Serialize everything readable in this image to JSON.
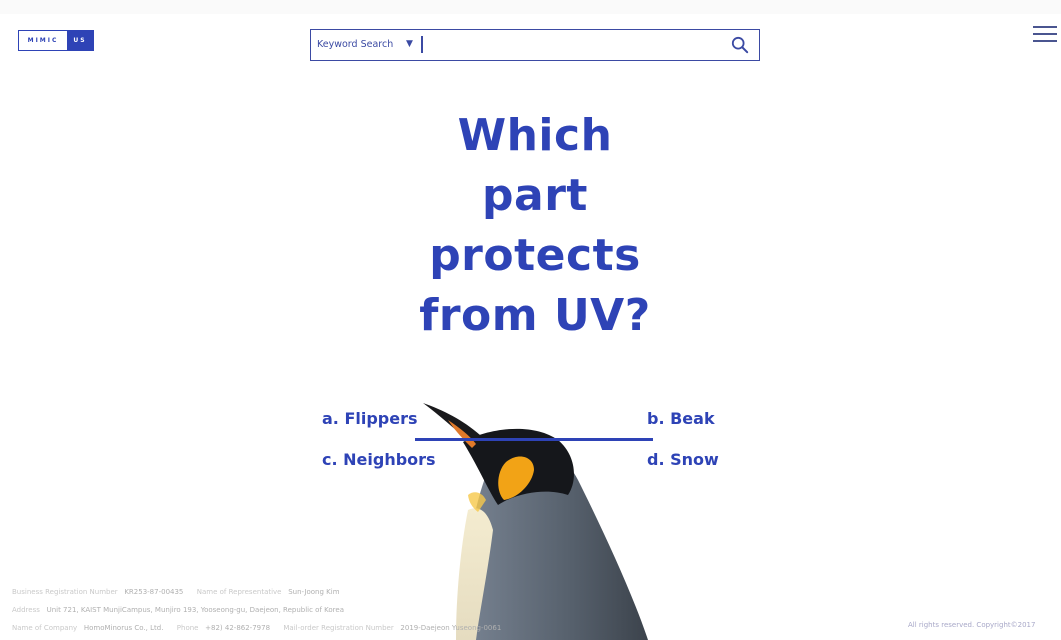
{
  "header": {
    "logo": {
      "left": "MIMIC",
      "right": "US"
    },
    "search": {
      "type_label": "Keyword Search",
      "caret": "▼",
      "value": ""
    },
    "menu_icon": "hamburger-icon"
  },
  "question": {
    "lines": [
      "Which",
      "part",
      "protects",
      "from UV?"
    ]
  },
  "answers": {
    "a": "a. Flippers",
    "b": "b. Beak",
    "c": "c. Neighbors",
    "d": "d. Snow"
  },
  "footer": {
    "reg_label": "Business Registration Number",
    "reg_value": "KR253-87-00435",
    "rep_label": "Name of Representative",
    "rep_value": "Sun-Joong Kim",
    "addr_label": "Address",
    "addr_value": "Unit 721, KAIST MunjiCampus, Munjiro 193, Yooseong-gu, Daejeon, Republic of Korea",
    "company_label": "Name of Company",
    "company_value": "HomoMinorus Co., Ltd.",
    "phone_label": "Phone",
    "phone_value": "+82) 42-862-7978",
    "mailorder_label": "Mail-order Registration Number",
    "mailorder_value": "2019-Daejeon Yuseong-0061",
    "copyright": "All rights reserved. Copyright©2017"
  },
  "colors": {
    "brand": "#2e43b6",
    "footer_text": "#c9c9c9"
  }
}
